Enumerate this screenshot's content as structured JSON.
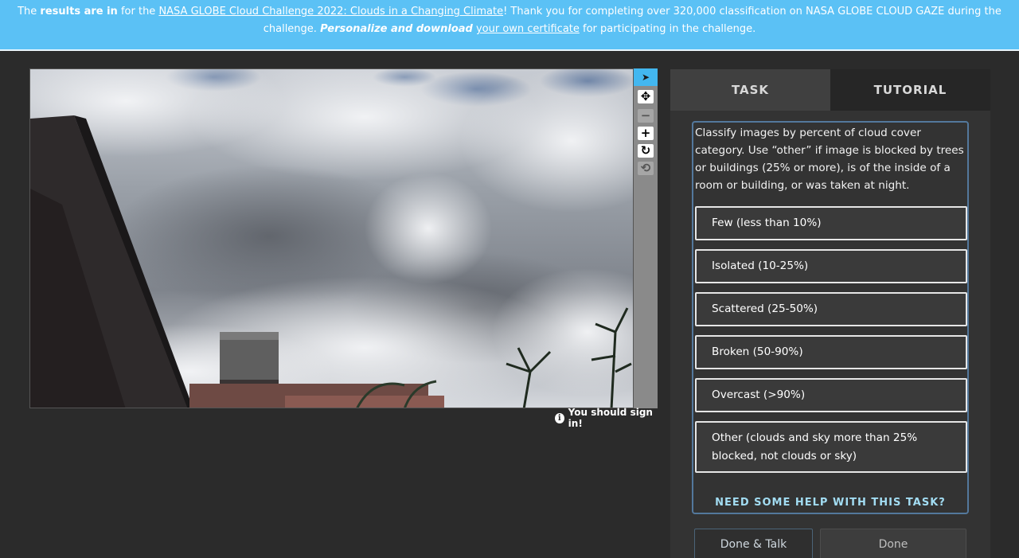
{
  "banner": {
    "part1": "The ",
    "bold1": "results are in",
    "part2": " for the ",
    "link1": "NASA GLOBE Cloud Challenge 2022: Clouds in a Changing Climate",
    "part3": "! Thank you for completing over 320,000 classification on NASA GLOBE CLOUD GAZE during the challenge. ",
    "bold2": "Personalize and download",
    "part4": " ",
    "link2": "your own certificate",
    "part5": " for participating in the challenge.",
    "bg_color": "#5bc1f5"
  },
  "toolbar": {
    "tools": [
      {
        "name": "pointer-icon",
        "glyph": "➤"
      },
      {
        "name": "move-icon",
        "glyph": "✥"
      },
      {
        "name": "zoom-out-icon",
        "glyph": "−"
      },
      {
        "name": "zoom-in-icon",
        "glyph": "+"
      },
      {
        "name": "rotate-icon",
        "glyph": "↻"
      },
      {
        "name": "reset-icon",
        "glyph": "⟲"
      }
    ],
    "active_color": "#43b7f0"
  },
  "signin": {
    "icon": "info-icon",
    "icon_glyph": "i",
    "text": "You should sign in!"
  },
  "tabs": {
    "task": "TASK",
    "tutorial": "TUTORIAL"
  },
  "task": {
    "question": "Classify images by percent of cloud cover category. Use “other” if image is blocked by trees or buildings (25% or more), is of the inside of a room or building, or was taken at night.",
    "answers": [
      "Few (less than 10%)",
      "Isolated (10-25%)",
      "Scattered (25-50%)",
      "Broken (50-90%)",
      "Overcast (>90%)",
      "Other (clouds and sky more than 25% blocked, not clouds or sky)"
    ],
    "help": "NEED SOME HELP WITH THIS TASK?",
    "border_color": "#53789c"
  },
  "buttons": {
    "done_talk": "Done & Talk",
    "done": "Done"
  }
}
